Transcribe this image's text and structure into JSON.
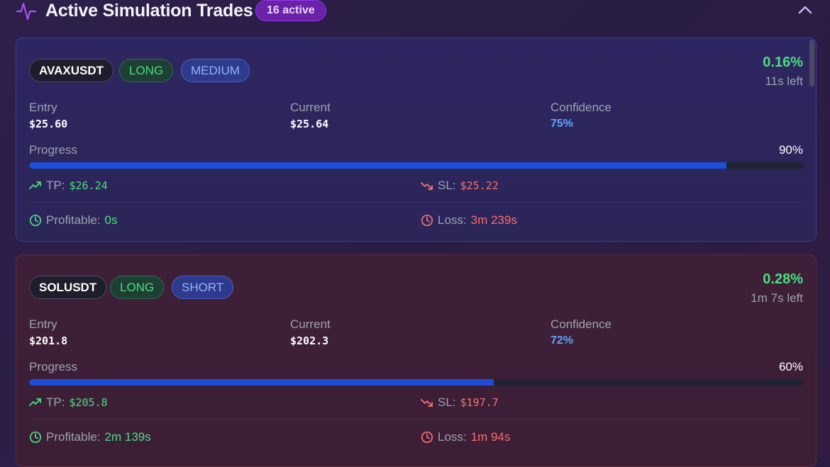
{
  "header": {
    "title": "Active Simulation Trades",
    "count_badge": "16 active",
    "pulse_icon": "activity-icon",
    "collapse_icon": "chevron-up-icon"
  },
  "trades": [
    {
      "symbol": "AVAXUSDT",
      "side": "LONG",
      "tag": "MEDIUM",
      "pnl_pct": "0.16%",
      "time_left": "11s left",
      "entry_label": "Entry",
      "entry": "$25.60",
      "current_label": "Current",
      "current": "$25.64",
      "confidence_label": "Confidence",
      "confidence": "75%",
      "progress_label": "Progress",
      "progress_text": "90%",
      "progress_fraction": 0.9,
      "tp_label": "TP:",
      "tp": "$26.24",
      "sl_label": "SL:",
      "sl": "$25.22",
      "profitable_label": "Profitable:",
      "profitable": "0s",
      "loss_label": "Loss:",
      "loss": "3m 239s"
    },
    {
      "symbol": "SOLUSDT",
      "side": "LONG",
      "tag": "SHORT",
      "pnl_pct": "0.28%",
      "time_left": "1m 7s left",
      "entry_label": "Entry",
      "entry": "$201.8",
      "current_label": "Current",
      "current": "$202.3",
      "confidence_label": "Confidence",
      "confidence": "72%",
      "progress_label": "Progress",
      "progress_text": "60%",
      "progress_fraction": 0.6,
      "tp_label": "TP:",
      "tp": "$205.8",
      "sl_label": "SL:",
      "sl": "$197.7",
      "profitable_label": "Profitable:",
      "profitable": "2m 139s",
      "loss_label": "Loss:",
      "loss": "1m 94s"
    }
  ],
  "colors": {
    "accent_purple": "#a855f7",
    "profit_green": "#4ade80",
    "loss_red": "#f87171",
    "progress_blue": "#1d4ed8",
    "confidence_blue": "#60a5fa"
  }
}
